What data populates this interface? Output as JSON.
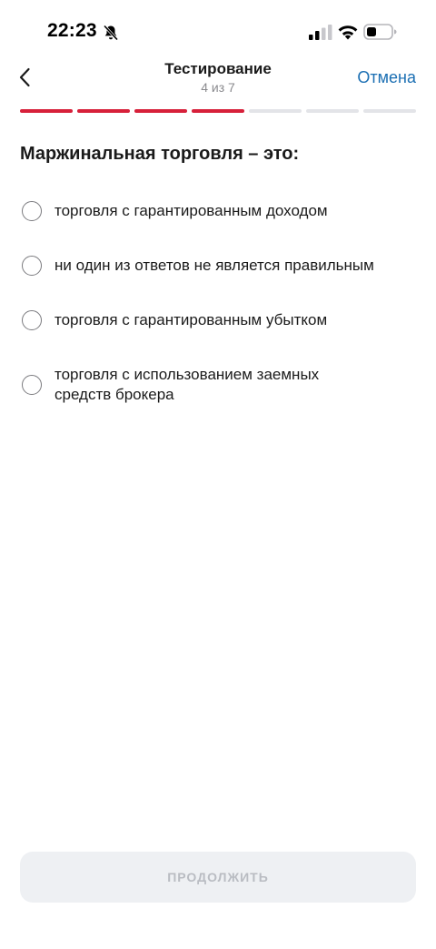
{
  "status_bar": {
    "time": "22:23"
  },
  "header": {
    "title": "Тестирование",
    "subtitle": "4 из 7",
    "cancel_label": "Отмена"
  },
  "progress": {
    "current": 4,
    "total": 7
  },
  "question": {
    "text": "Маржинальная торговля – это:"
  },
  "options": [
    {
      "label": "торговля с гарантированным доходом"
    },
    {
      "label": "ни один из ответов не является правильным"
    },
    {
      "label": "торговля с гарантированным убытком"
    },
    {
      "label": "торговля с использованием заемных средств брокера"
    }
  ],
  "footer": {
    "continue_label": "ПРОДОЛЖИТЬ"
  },
  "colors": {
    "accent_red": "#d7203a",
    "link_blue": "#1b6fb3",
    "inactive_progress": "#e3e4e8",
    "disabled_button_bg": "#eef0f3",
    "disabled_button_text": "#b9bcc2"
  },
  "icons": {
    "back": "chevron-left-icon",
    "mute": "bell-slash-icon",
    "signal": "cellular-signal-icon",
    "wifi": "wifi-icon",
    "battery": "battery-icon"
  }
}
